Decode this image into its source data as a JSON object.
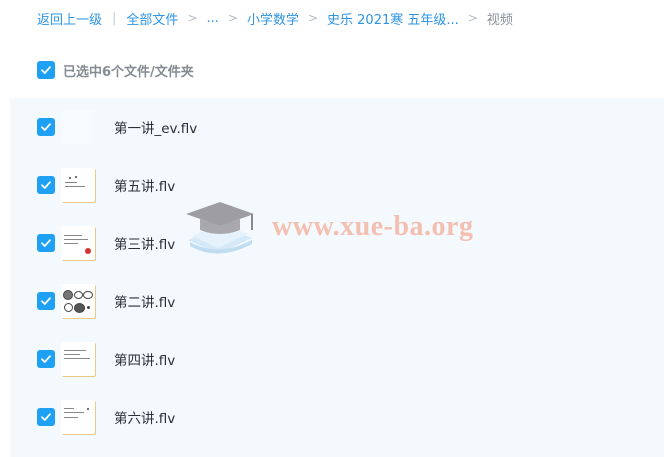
{
  "breadcrumb": {
    "back": "返回上一级",
    "separator": "|",
    "all_files": "全部文件",
    "ellipsis": "...",
    "level1": "小学数学",
    "level2": "史乐 2021寒 五年级...",
    "current": "视频"
  },
  "selection": {
    "label": "已选中6个文件/文件夹",
    "checked": true
  },
  "files": [
    {
      "name": "第一讲_ev.flv",
      "checked": true
    },
    {
      "name": "第五讲.flv",
      "checked": true
    },
    {
      "name": "第三讲.flv",
      "checked": true
    },
    {
      "name": "第二讲.flv",
      "checked": true
    },
    {
      "name": "第四讲.flv",
      "checked": true
    },
    {
      "name": "第六讲.flv",
      "checked": true
    }
  ],
  "watermark": {
    "text": "www.xue-ba.org"
  },
  "colors": {
    "accent": "#1ea0f5",
    "link": "#2e94e6",
    "list_background": "#f4f9fe",
    "watermark": "#f3b5a4"
  }
}
